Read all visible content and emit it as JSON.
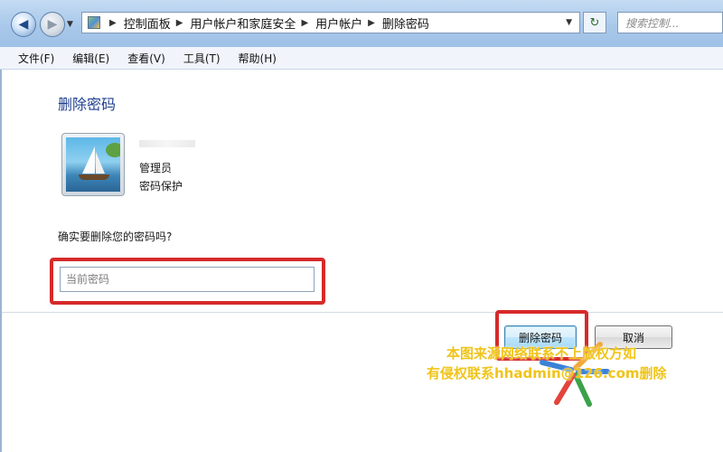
{
  "breadcrumb": [
    "控制面板",
    "用户帐户和家庭安全",
    "用户帐户",
    "删除密码"
  ],
  "search": {
    "placeholder": "搜索控制..."
  },
  "menu": [
    "文件(F)",
    "编辑(E)",
    "查看(V)",
    "工具(T)",
    "帮助(H)"
  ],
  "page": {
    "title": "删除密码",
    "user": {
      "role": "管理员",
      "protection": "密码保护"
    },
    "question": "确实要删除您的密码吗?",
    "password_input": {
      "placeholder": "当前密码",
      "value": ""
    },
    "buttons": {
      "delete": "删除密码",
      "cancel": "取消"
    }
  },
  "watermark": {
    "line1": "本图来源网络联系不上版权方如",
    "line2": "有侵权联系hhadmin@126.com删除"
  },
  "colors": {
    "accent_title": "#1e3f8f",
    "highlight_frame": "#d62a2a",
    "watermark": "#f0c419"
  }
}
